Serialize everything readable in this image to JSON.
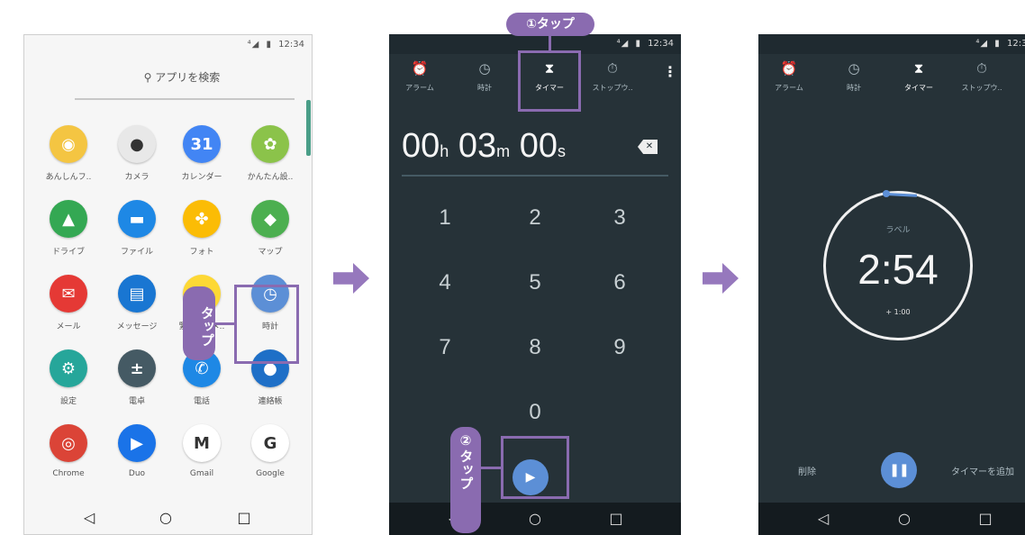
{
  "status": {
    "signal": "⁴◢",
    "battery": "▮",
    "time": "12:34"
  },
  "launcher": {
    "search_placeholder": "アプリを検索",
    "apps": [
      {
        "label": "あんしんフ..",
        "icon": "shield-app-icon",
        "glyph": "◉",
        "color": "#f4c542"
      },
      {
        "label": "カメラ",
        "icon": "camera-app-icon",
        "glyph": "●",
        "color": "#e8e8e8"
      },
      {
        "label": "カレンダー",
        "icon": "calendar-app-icon",
        "glyph": "31",
        "color": "#4285f4"
      },
      {
        "label": "かんたん設..",
        "icon": "easy-settings-app-icon",
        "glyph": "✿",
        "color": "#8bc34a"
      },
      {
        "label": "ドライブ",
        "icon": "drive-app-icon",
        "glyph": "▲",
        "color": "#34a853"
      },
      {
        "label": "ファイル",
        "icon": "files-app-icon",
        "glyph": "▬",
        "color": "#1e88e5"
      },
      {
        "label": "フォト",
        "icon": "photos-app-icon",
        "glyph": "✤",
        "color": "#fbbc05"
      },
      {
        "label": "マップ",
        "icon": "maps-app-icon",
        "glyph": "◆",
        "color": "#4caf50"
      },
      {
        "label": "メール",
        "icon": "mail-app-icon",
        "glyph": "✉",
        "color": "#e53935"
      },
      {
        "label": "メッセージ",
        "icon": "messages-app-icon",
        "glyph": "▤",
        "color": "#1976d2"
      },
      {
        "label": "緊急速報メ..",
        "icon": "emergency-alert-app-icon",
        "glyph": "!",
        "color": "#fdd835"
      },
      {
        "label": "時計",
        "icon": "clock-app-icon",
        "glyph": "◷",
        "color": "#5c8fd6"
      },
      {
        "label": "設定",
        "icon": "settings-app-icon",
        "glyph": "⚙",
        "color": "#26a69a"
      },
      {
        "label": "電卓",
        "icon": "calculator-app-icon",
        "glyph": "±",
        "color": "#455a64"
      },
      {
        "label": "電話",
        "icon": "phone-app-icon",
        "glyph": "✆",
        "color": "#1e88e5"
      },
      {
        "label": "連絡帳",
        "icon": "contacts-app-icon",
        "glyph": "●",
        "color": "#1e6fc7"
      },
      {
        "label": "Chrome",
        "icon": "chrome-app-icon",
        "glyph": "◎",
        "color": "#db4437"
      },
      {
        "label": "Duo",
        "icon": "duo-app-icon",
        "glyph": "▶",
        "color": "#1a73e8"
      },
      {
        "label": "Gmail",
        "icon": "gmail-app-icon",
        "glyph": "M",
        "color": "#ffffff"
      },
      {
        "label": "Google",
        "icon": "google-app-icon",
        "glyph": "G",
        "color": "#ffffff"
      }
    ]
  },
  "tabs": [
    {
      "label": "アラーム",
      "icon": "alarm-icon",
      "glyph": "⏰"
    },
    {
      "label": "時計",
      "icon": "clock-icon",
      "glyph": "◷"
    },
    {
      "label": "タイマー",
      "icon": "hourglass-icon",
      "glyph": "⧗"
    },
    {
      "label": "ストップウ..",
      "icon": "stopwatch-icon",
      "glyph": "⏱"
    }
  ],
  "timer_input": {
    "hours": "00",
    "hours_unit": "h",
    "minutes": "03",
    "minutes_unit": "m",
    "seconds": "00",
    "seconds_unit": "s",
    "keys": [
      "1",
      "2",
      "3",
      "4",
      "5",
      "6",
      "7",
      "8",
      "9",
      "0"
    ]
  },
  "running_timer": {
    "label": "ラベル",
    "time": "2:54",
    "add_minute": "+ 1:00",
    "delete": "削除",
    "add_timer": "タイマーを追加"
  },
  "callouts": {
    "tap1": "タップ",
    "tap_step1": "①タップ",
    "tap_step2_num": "②",
    "tap_step2": "タップ"
  },
  "nav": {
    "back": "◁",
    "home": "○",
    "recents": "□"
  }
}
